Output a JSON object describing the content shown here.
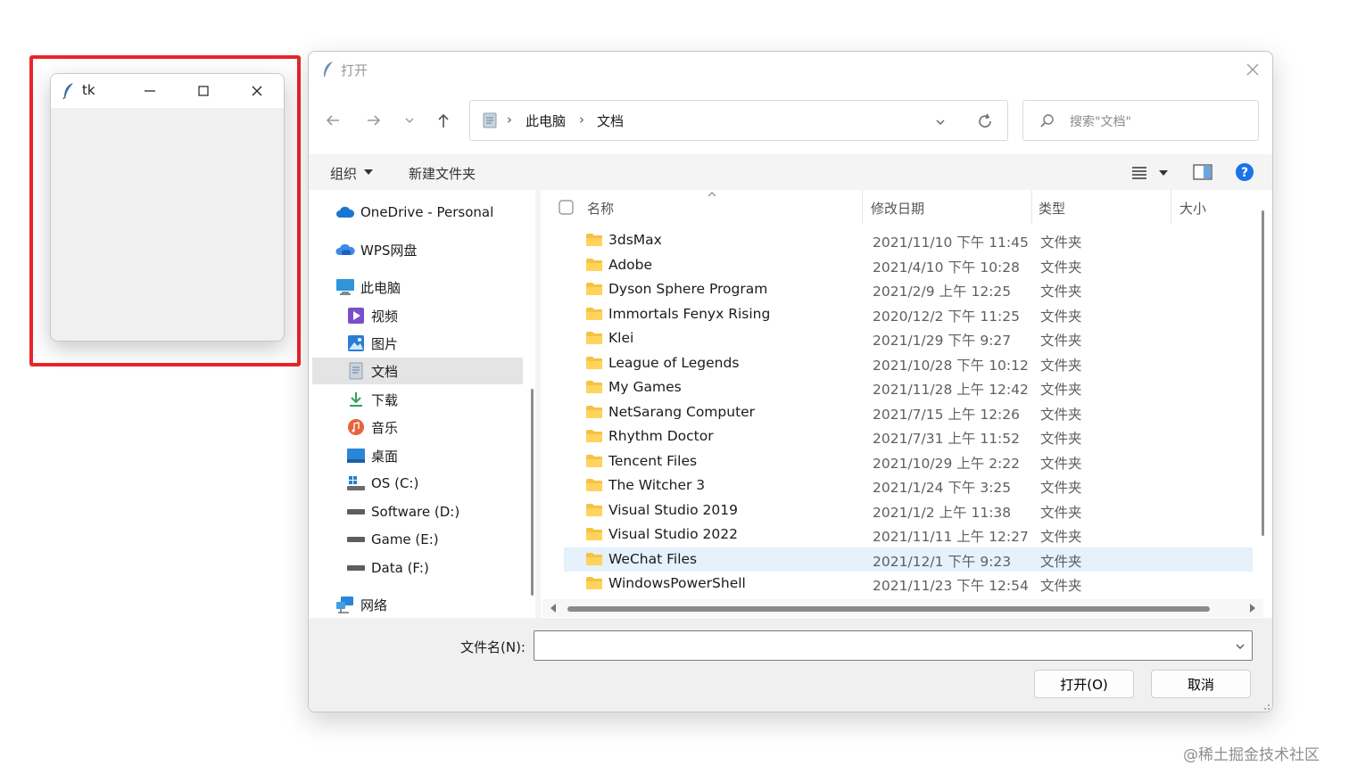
{
  "tk_window": {
    "title": "tk"
  },
  "dialog": {
    "title": "打开",
    "breadcrumb": [
      "此电脑",
      "文档"
    ],
    "search_placeholder": "搜索\"文档\"",
    "toolbar": {
      "organize": "组织",
      "new_folder": "新建文件夹"
    },
    "sidebar": [
      {
        "label": "OneDrive - Personal",
        "icon": "onedrive-cloud-icon"
      },
      {
        "label": "WPS网盘",
        "icon": "wps-cloud-icon"
      },
      {
        "label": "此电脑",
        "icon": "computer-icon"
      },
      {
        "label": "视频",
        "icon": "video-icon"
      },
      {
        "label": "图片",
        "icon": "picture-icon"
      },
      {
        "label": "文档",
        "icon": "document-icon"
      },
      {
        "label": "下载",
        "icon": "download-icon"
      },
      {
        "label": "音乐",
        "icon": "music-icon"
      },
      {
        "label": "桌面",
        "icon": "desktop-icon"
      },
      {
        "label": "OS (C:)",
        "icon": "windows-drive-icon"
      },
      {
        "label": "Software (D:)",
        "icon": "drive-icon"
      },
      {
        "label": "Game (E:)",
        "icon": "drive-icon"
      },
      {
        "label": "Data (F:)",
        "icon": "drive-icon"
      },
      {
        "label": "网络",
        "icon": "network-icon"
      }
    ],
    "columns": {
      "name": "名称",
      "modified": "修改日期",
      "type": "类型",
      "size": "大小"
    },
    "files": [
      {
        "name": "3dsMax",
        "date": "2021/11/10 下午 11:45",
        "type": "文件夹"
      },
      {
        "name": "Adobe",
        "date": "2021/4/10 下午 10:28",
        "type": "文件夹"
      },
      {
        "name": "Dyson Sphere Program",
        "date": "2021/2/9 上午 12:25",
        "type": "文件夹"
      },
      {
        "name": "Immortals Fenyx Rising",
        "date": "2020/12/2 下午 11:25",
        "type": "文件夹"
      },
      {
        "name": "Klei",
        "date": "2021/1/29 下午 9:27",
        "type": "文件夹"
      },
      {
        "name": "League of Legends",
        "date": "2021/10/28 下午 10:12",
        "type": "文件夹"
      },
      {
        "name": "My Games",
        "date": "2021/11/28 上午 12:42",
        "type": "文件夹"
      },
      {
        "name": "NetSarang Computer",
        "date": "2021/7/15 上午 12:26",
        "type": "文件夹"
      },
      {
        "name": "Rhythm Doctor",
        "date": "2021/7/31 上午 11:52",
        "type": "文件夹"
      },
      {
        "name": "Tencent Files",
        "date": "2021/10/29 上午 2:22",
        "type": "文件夹"
      },
      {
        "name": "The Witcher 3",
        "date": "2021/1/24 下午 3:25",
        "type": "文件夹"
      },
      {
        "name": "Visual Studio 2019",
        "date": "2021/1/2 上午 11:38",
        "type": "文件夹"
      },
      {
        "name": "Visual Studio 2022",
        "date": "2021/11/11 上午 12:27",
        "type": "文件夹"
      },
      {
        "name": "WeChat Files",
        "date": "2021/12/1 下午 9:23",
        "type": "文件夹"
      },
      {
        "name": "WindowsPowerShell",
        "date": "2021/11/23 下午 12:54",
        "type": "文件夹"
      }
    ],
    "filename_label": "文件名(N):",
    "filename_value": "",
    "open_button": "打开(O)",
    "cancel_button": "取消"
  },
  "watermark": "@稀土掘金技术社区",
  "colors": {
    "highlight_frame": "#e8262a",
    "folder": "#f5c242",
    "selected_row": "#e5f1fb",
    "help": "#1a73e8"
  }
}
